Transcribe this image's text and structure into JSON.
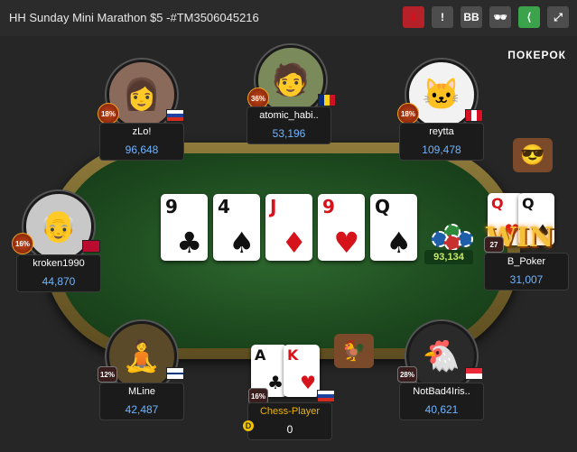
{
  "header": {
    "title": "HH Sunday Mini Marathon $5 -#TM3506045216",
    "buttons": {
      "download": "⬇",
      "report": "!",
      "bb": "BB",
      "anon": "🕶",
      "share": "⟨",
      "fullscreen": "⤢"
    }
  },
  "brand": "ПОКЕРОК",
  "board": [
    {
      "rank": "9",
      "suit": "♣",
      "color": "black"
    },
    {
      "rank": "4",
      "suit": "♠",
      "color": "black"
    },
    {
      "rank": "J",
      "suit": "♦",
      "color": "red"
    },
    {
      "rank": "9",
      "suit": "♥",
      "color": "red"
    },
    {
      "rank": "Q",
      "suit": "♠",
      "color": "black"
    }
  ],
  "pot": "93,134",
  "win_text": "WIN",
  "players": {
    "zlo": {
      "name": "zLo!",
      "stack": "96,648",
      "badge": "18%"
    },
    "atomic": {
      "name": "atomic_habi..",
      "stack": "53,196",
      "badge": "36%"
    },
    "reytta": {
      "name": "reytta",
      "stack": "109,478",
      "badge": "18%"
    },
    "kroken": {
      "name": "kroken1990",
      "stack": "44,870",
      "badge": "16%"
    },
    "bpoker": {
      "name": "B_Poker",
      "stack": "31,007",
      "badge": "27",
      "cards": [
        {
          "rank": "Q",
          "suit": "♥",
          "color": "red"
        },
        {
          "rank": "Q",
          "suit": "♠",
          "color": "black"
        }
      ]
    },
    "mline": {
      "name": "MLine",
      "stack": "42,487",
      "badge": "12%"
    },
    "chess": {
      "name": "Chess-Player",
      "stack": "0",
      "badge": "16%",
      "cards": [
        {
          "rank": "A",
          "suit": "♣",
          "color": "black"
        },
        {
          "rank": "K",
          "suit": "♥",
          "color": "red"
        }
      ]
    },
    "notbad": {
      "name": "NotBad4Iris..",
      "stack": "40,621",
      "badge": "28%"
    }
  },
  "dealer_button": "D",
  "colors": {
    "felt": "#1d4a1f",
    "stack_blue": "#6fb4ff",
    "hero_name": "#f0b400",
    "pot_green": "#c8e86c"
  }
}
